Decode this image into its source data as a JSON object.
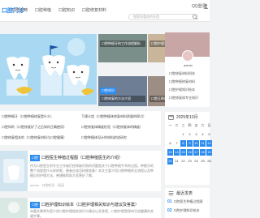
{
  "site": {
    "logo": "口腔门诊",
    "qq": "QQ登录"
  },
  "nav": [
    "口腔正畸",
    "口腔种植",
    "口腔知识",
    "口腔修复材料"
  ],
  "search": {
    "placeholder": "搜索你喜欢的东西"
  },
  "thumbs": [
    {
      "caption": "口腔种植牙的工作流程解析"
    },
    {
      "caption": "口腔护理宣传知识"
    },
    {
      "caption": "口腔修复的方法介绍"
    },
    {
      "caption": "口腔正畸科的诊疗"
    }
  ],
  "badge": "口腔知识",
  "links": [
    "口腔种植牙（口腔种植修复是什么）",
    "下颌义齿（口腔种植体修复材料质量的探讨）",
    "口腔科的（口腔修复好了之后如何正确使用）",
    "口腔修复体精度检验（口腔修复体的精度）",
    "口腔修复相关的（口腔修复材料与口腔健康）",
    "口腔种植体设计的材料综述研究"
  ],
  "cards": [
    {
      "tag": "口腔",
      "title": "口腔医生种植过程图（口腔种植医生的介绍）",
      "body": "作为口腔医生的专业工作者们经常被问到的问题是关于口腔种植手术的过程。种植牙的整个流程是什么样的呢，患者应该怎样做准备？本文主要介绍口腔种植的全流程以及种植后的护理方法，希望能帮助大家更好了解。",
      "meta": "admin · 口腔知识 · 阅读"
    },
    {
      "tag": "口腔",
      "title": "口腔护理知识绘本（口腔护理相关知识与建议及答案）",
      "body": "本篇文章将为您介绍口腔护理相关知识与建议以及答案，口腔护理是保持牙齿健康的关键步骤。",
      "meta": ""
    }
  ],
  "profile": {
    "name": "admin",
    "links": [
      "口腔修复材料科技",
      "口腔种植修复材料",
      "口腔护理知识绘本",
      "口腔修复体专业知识"
    ]
  },
  "calendar": {
    "title": "2025年10月",
    "weekdays": [
      "一",
      "二",
      "三",
      "四",
      "五",
      "六",
      "日"
    ],
    "days": [
      "",
      "",
      "1",
      "2",
      "3",
      "4",
      "5",
      "6",
      "7",
      "8",
      "9",
      "10",
      "11",
      "12",
      "13",
      "14",
      "15",
      "16",
      "17",
      "18",
      "19",
      "20",
      "21",
      "22",
      "23",
      "24",
      "25",
      "26"
    ]
  },
  "recent": {
    "title": "最近发表",
    "items": [
      {
        "no": "01",
        "text": "口腔医生种植过程图"
      },
      {
        "no": "02",
        "text": "口腔护理知识绘本"
      }
    ]
  },
  "colors": {
    "accent": "#2d8cf0",
    "hero_bg": "#a9d8f2"
  }
}
